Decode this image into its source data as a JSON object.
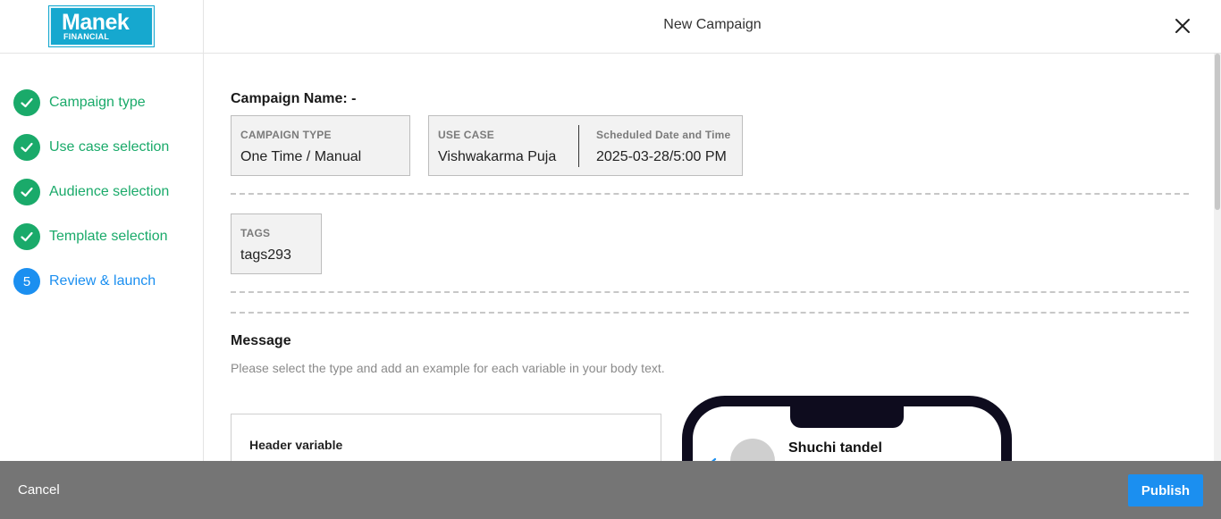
{
  "header": {
    "logo_main": "Manek",
    "logo_sub": "FINANCIAL",
    "title": "New Campaign"
  },
  "steps": [
    {
      "label": "Campaign type",
      "status": "done"
    },
    {
      "label": "Use case selection",
      "status": "done"
    },
    {
      "label": "Audience selection",
      "status": "done"
    },
    {
      "label": "Template selection",
      "status": "done"
    },
    {
      "label": "Review & launch",
      "status": "current",
      "number": "5"
    }
  ],
  "review": {
    "campaign_name": "Campaign Name: -",
    "campaign_type_label": "CAMPAIGN TYPE",
    "campaign_type_value": "One Time / Manual",
    "use_case_label": "USE CASE",
    "use_case_value": "Vishwakarma Puja",
    "schedule_label": "Scheduled Date and Time",
    "schedule_value": "2025-03-28/5:00 PM",
    "tags_label": "TAGS",
    "tags_value": "tags293"
  },
  "message": {
    "title": "Message",
    "subtitle": "Please select the type and add an example for each variable in your body text.",
    "header_variable_label": "Header variable"
  },
  "preview": {
    "contact_name": "Shuchi tandel"
  },
  "footer": {
    "cancel_label": "Cancel",
    "publish_label": "Publish"
  },
  "colors": {
    "done": "#1aaa6a",
    "current": "#1b8ff0",
    "footer_bg": "#757575",
    "logo_bg": "#16a8cf"
  }
}
